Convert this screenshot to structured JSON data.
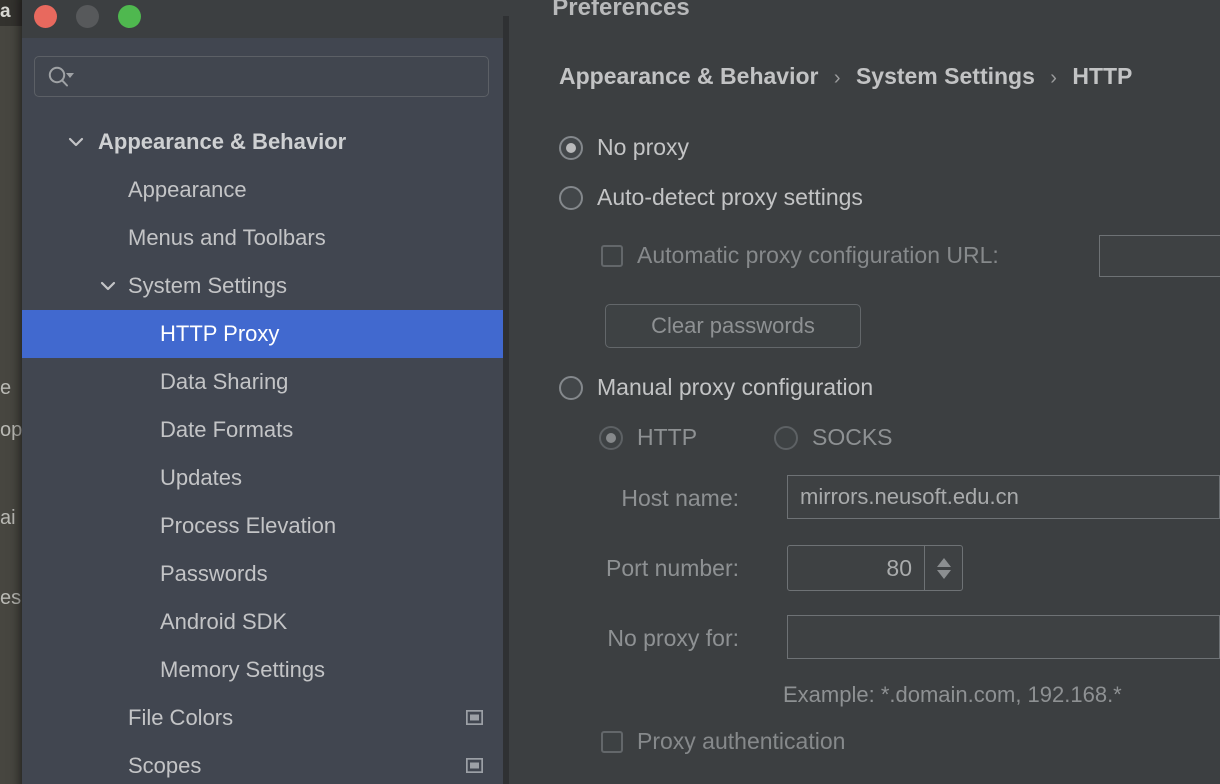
{
  "window": {
    "title": "Preferences",
    "traffic_lights": [
      {
        "name": "close",
        "color": "#e8695e"
      },
      {
        "name": "minimize",
        "color": "#57595b"
      },
      {
        "name": "maximize",
        "color": "#4fb84f"
      }
    ]
  },
  "background": {
    "fragments": [
      "a",
      "e",
      "op",
      "ai",
      "es"
    ]
  },
  "sidebar": {
    "search": {
      "value": "",
      "placeholder": ""
    },
    "items": [
      {
        "label": "Appearance & Behavior",
        "level": 0,
        "expanded": true,
        "selected": false,
        "icon": null
      },
      {
        "label": "Appearance",
        "level": 1,
        "expanded": null,
        "selected": false,
        "icon": null
      },
      {
        "label": "Menus and Toolbars",
        "level": 1,
        "expanded": null,
        "selected": false,
        "icon": null
      },
      {
        "label": "System Settings",
        "level": 1,
        "expanded": true,
        "selected": false,
        "icon": null
      },
      {
        "label": "HTTP Proxy",
        "level": 2,
        "expanded": null,
        "selected": true,
        "icon": null
      },
      {
        "label": "Data Sharing",
        "level": 2,
        "expanded": null,
        "selected": false,
        "icon": null
      },
      {
        "label": "Date Formats",
        "level": 2,
        "expanded": null,
        "selected": false,
        "icon": null
      },
      {
        "label": "Updates",
        "level": 2,
        "expanded": null,
        "selected": false,
        "icon": null
      },
      {
        "label": "Process Elevation",
        "level": 2,
        "expanded": null,
        "selected": false,
        "icon": null
      },
      {
        "label": "Passwords",
        "level": 2,
        "expanded": null,
        "selected": false,
        "icon": null
      },
      {
        "label": "Android SDK",
        "level": 2,
        "expanded": null,
        "selected": false,
        "icon": null
      },
      {
        "label": "Memory Settings",
        "level": 2,
        "expanded": null,
        "selected": false,
        "icon": null
      },
      {
        "label": "File Colors",
        "level": 1,
        "expanded": null,
        "selected": false,
        "icon": "project-scope-icon"
      },
      {
        "label": "Scopes",
        "level": 1,
        "expanded": null,
        "selected": false,
        "icon": "project-scope-icon"
      }
    ],
    "selected_index": 4
  },
  "breadcrumb": {
    "parts": [
      "Appearance & Behavior",
      "System Settings",
      "HTTP"
    ],
    "separator": "›"
  },
  "proxy": {
    "mode": "no_proxy",
    "options": [
      {
        "id": "no_proxy",
        "label": "No proxy",
        "checked": true,
        "enabled": true
      },
      {
        "id": "auto_detect",
        "label": "Auto-detect proxy settings",
        "checked": false,
        "enabled": true
      },
      {
        "id": "manual",
        "label": "Manual proxy configuration",
        "checked": false,
        "enabled": true
      }
    ],
    "auto_config": {
      "checkbox_label": "Automatic proxy configuration URL:",
      "checked": false,
      "url_value": "",
      "clear_passwords_label": "Clear passwords"
    },
    "manual": {
      "protocol": "HTTP",
      "protocols": [
        {
          "id": "http",
          "label": "HTTP",
          "checked": true
        },
        {
          "id": "socks",
          "label": "SOCKS",
          "checked": false
        }
      ],
      "host_label": "Host name:",
      "host_value": "mirrors.neusoft.edu.cn",
      "port_label": "Port number:",
      "port_value": "80",
      "no_proxy_label": "No proxy for:",
      "no_proxy_value": "",
      "example_hint": "Example: *.domain.com, 192.168.*",
      "auth_label": "Proxy authentication",
      "auth_checked": false
    }
  },
  "colors": {
    "dialog_bg": "#3c3f41",
    "sidebar_bg": "#414650",
    "selection_blue": "#4169cf",
    "text_primary": "#c3c4c6",
    "text_dim": "#8e9193"
  }
}
